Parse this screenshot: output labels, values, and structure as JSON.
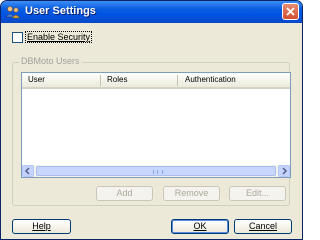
{
  "window": {
    "title": "User Settings",
    "accent": "#0054e3"
  },
  "security": {
    "enable_label": "Enable Security",
    "checked": false
  },
  "users_group": {
    "legend": "DBMoto Users",
    "columns": [
      "User",
      "Roles",
      "Authentication"
    ],
    "rows": []
  },
  "actions": {
    "add": "Add",
    "remove": "Remove",
    "edit": "Edit..."
  },
  "footer": {
    "help": "Help",
    "ok": "OK",
    "cancel": "Cancel"
  }
}
